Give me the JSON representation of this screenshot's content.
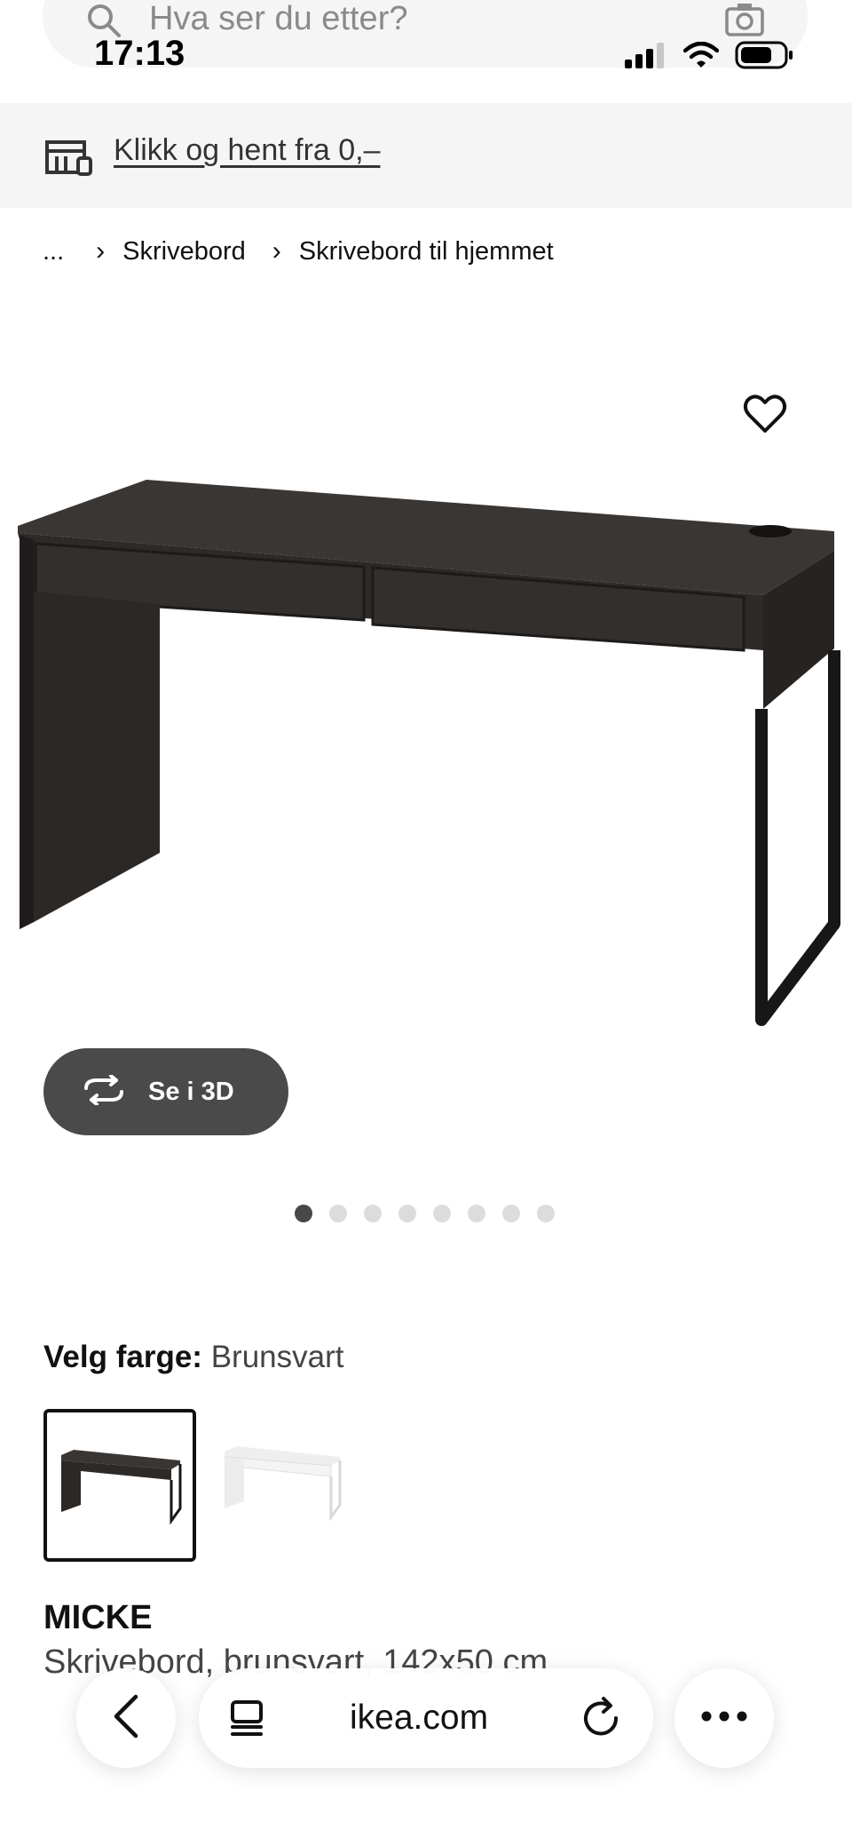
{
  "search": {
    "placeholder": "Hva ser du etter?"
  },
  "status_bar": {
    "time": "17:13"
  },
  "promo": {
    "link_text": "Klikk og hent fra 0,–"
  },
  "breadcrumb": {
    "ellipsis": "...",
    "items": [
      "Skrivebord",
      "Skrivebord til hjemmet"
    ]
  },
  "gallery": {
    "view_3d_label": "Se i 3D",
    "slide_count": 8,
    "active_slide": 1
  },
  "color_picker": {
    "label": "Velg farge:",
    "selected_value": "Brunsvart",
    "options": [
      "Brunsvart",
      "Hvit"
    ]
  },
  "product": {
    "name": "MICKE",
    "description": "Skrivebord, brunsvart, 142x50 cm"
  },
  "browser": {
    "url": "ikea.com"
  },
  "colors": {
    "desk_dark": "#2f2c2a",
    "button_dark": "#4a4a4a",
    "banner_bg": "#f5f5f5"
  }
}
